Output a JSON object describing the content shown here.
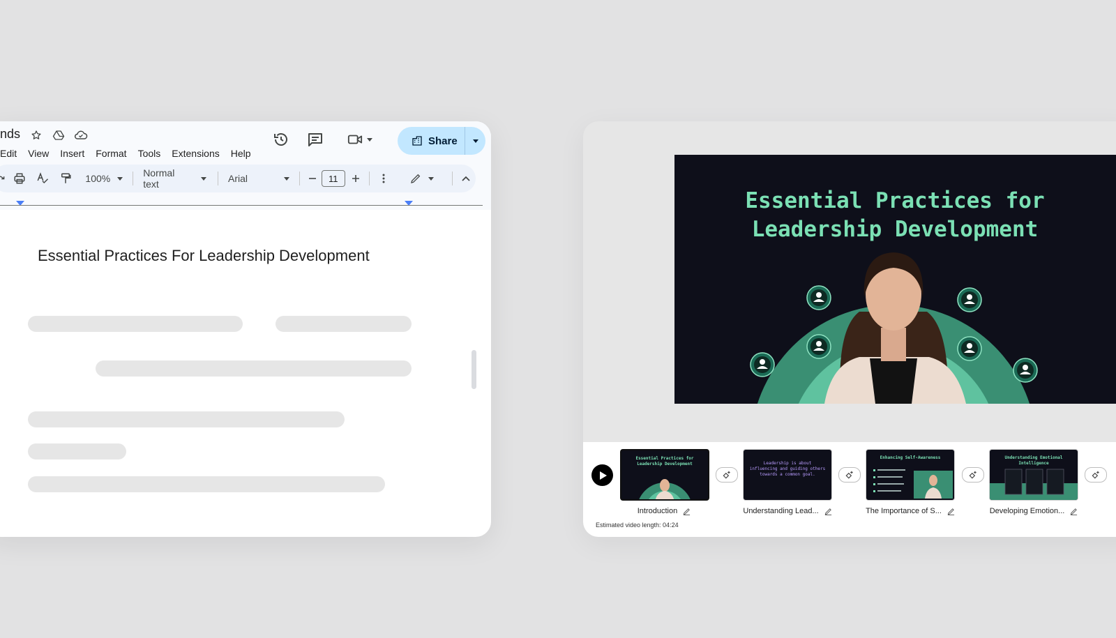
{
  "docs": {
    "title_fragment": "nds",
    "menu": [
      "Edit",
      "View",
      "Insert",
      "Format",
      "Tools",
      "Extensions",
      "Help"
    ],
    "share_label": "Share",
    "toolbar": {
      "zoom": "100%",
      "style": "Normal text",
      "font": "Arial",
      "font_size": "11"
    },
    "document_heading": "Essential Practices For Leadership Development"
  },
  "editor": {
    "preview_title": "Essential Practices for Leadership Development",
    "scenes": [
      {
        "label": "Introduction",
        "thumb_text": "Essential Practices for Leadership Development",
        "active": true
      },
      {
        "label": "Understanding Lead...",
        "thumb_text": "Leadership is about influencing and guiding others towards a common goal.",
        "active": false
      },
      {
        "label": "The Importance of S...",
        "thumb_text": "Enhancing Self-Awareness",
        "active": false
      },
      {
        "label": "Developing Emotion...",
        "thumb_text": "Understanding Emotional Intelligence",
        "active": false
      }
    ],
    "estimated_length": "Estimated video length: 04:24"
  },
  "colors": {
    "share_bg": "#c2e7ff",
    "slide_bg": "#0e0f1a",
    "slide_accent": "#7be0b4",
    "arc_dark": "#3a8f73",
    "arc_light": "#5fc29f"
  },
  "icons": [
    "star-icon",
    "drive-icon",
    "cloud-icon",
    "history-icon",
    "comment-icon",
    "video-call-icon",
    "share-lock-icon",
    "print-icon",
    "spellcheck-icon",
    "paint-format-icon",
    "minus-icon",
    "plus-icon",
    "more-icon",
    "pencil-icon",
    "chevron-up-icon",
    "play-icon",
    "transition-icon",
    "edit-icon"
  ]
}
